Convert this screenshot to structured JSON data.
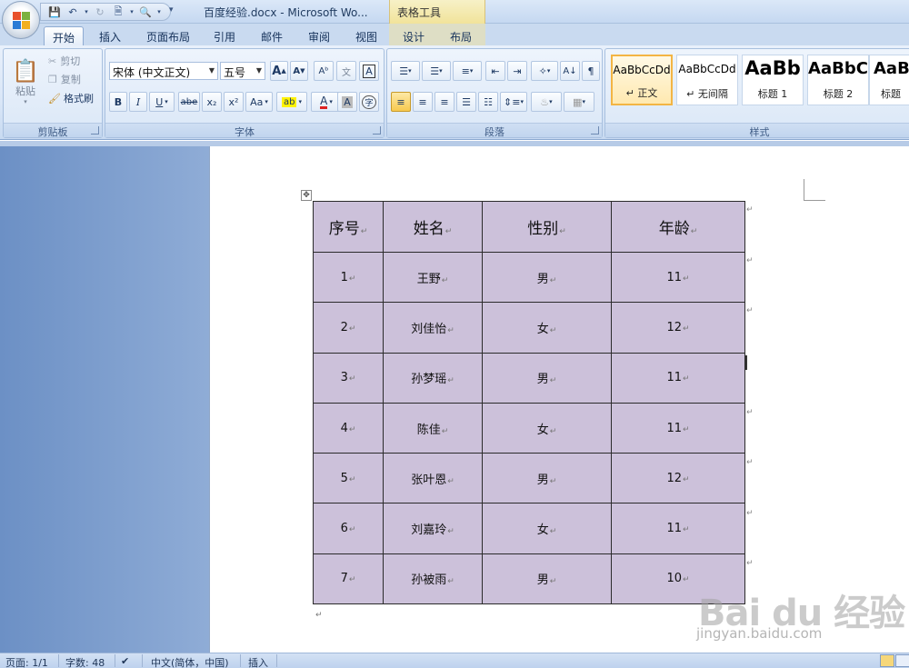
{
  "titlebar": {
    "doc_title": "百度经验.docx - Microsoft Wo...",
    "contextual_group": "表格工具"
  },
  "tabs": [
    {
      "label": "开始",
      "active": true
    },
    {
      "label": "插入"
    },
    {
      "label": "页面布局"
    },
    {
      "label": "引用"
    },
    {
      "label": "邮件"
    },
    {
      "label": "审阅"
    },
    {
      "label": "视图"
    },
    {
      "label": "设计"
    },
    {
      "label": "布局"
    }
  ],
  "clipboard": {
    "paste": "粘贴",
    "cut": "剪切",
    "copy": "复制",
    "format_painter": "格式刷",
    "group_label": "剪贴板"
  },
  "font": {
    "font_name": "宋体 (中文正文)",
    "font_size": "五号",
    "group_label": "字体",
    "bold": "B",
    "italic": "I",
    "underline": "U",
    "strike": "abe",
    "subscript": "x₂",
    "superscript": "x²",
    "change_case": "Aa",
    "grow": "A",
    "shrink": "A"
  },
  "paragraph": {
    "group_label": "段落"
  },
  "styles": {
    "group_label": "样式",
    "items": [
      {
        "sample": "AaBbCcDd",
        "name": "↵ 正文"
      },
      {
        "sample": "AaBbCcDd",
        "name": "↵ 无间隔"
      },
      {
        "sample": "AaBb",
        "name": "标题 1"
      },
      {
        "sample": "AaBbC",
        "name": "标题 2"
      },
      {
        "sample": "AaBb",
        "name": "标题"
      }
    ]
  },
  "table": {
    "headers": [
      "序号",
      "姓名",
      "性别",
      "年龄"
    ],
    "rows": [
      [
        "1",
        "王野",
        "男",
        "11"
      ],
      [
        "2",
        "刘佳怡",
        "女",
        "12"
      ],
      [
        "3",
        "孙梦瑶",
        "男",
        "11"
      ],
      [
        "4",
        "陈佳",
        "女",
        "11"
      ],
      [
        "5",
        "张叶恩",
        "男",
        "12"
      ],
      [
        "6",
        "刘嘉玲",
        "女",
        "11"
      ],
      [
        "7",
        "孙被雨",
        "男",
        "10"
      ]
    ],
    "para_mark": "↵",
    "cell_color": "#ccc1da"
  },
  "watermark": {
    "logo": "Bai du 经验",
    "url": "jingyan.baidu.com"
  },
  "statusbar": {
    "page": "页面: 1/1",
    "words": "字数: 48",
    "language": "中文(简体，中国)",
    "mode": "插入"
  }
}
